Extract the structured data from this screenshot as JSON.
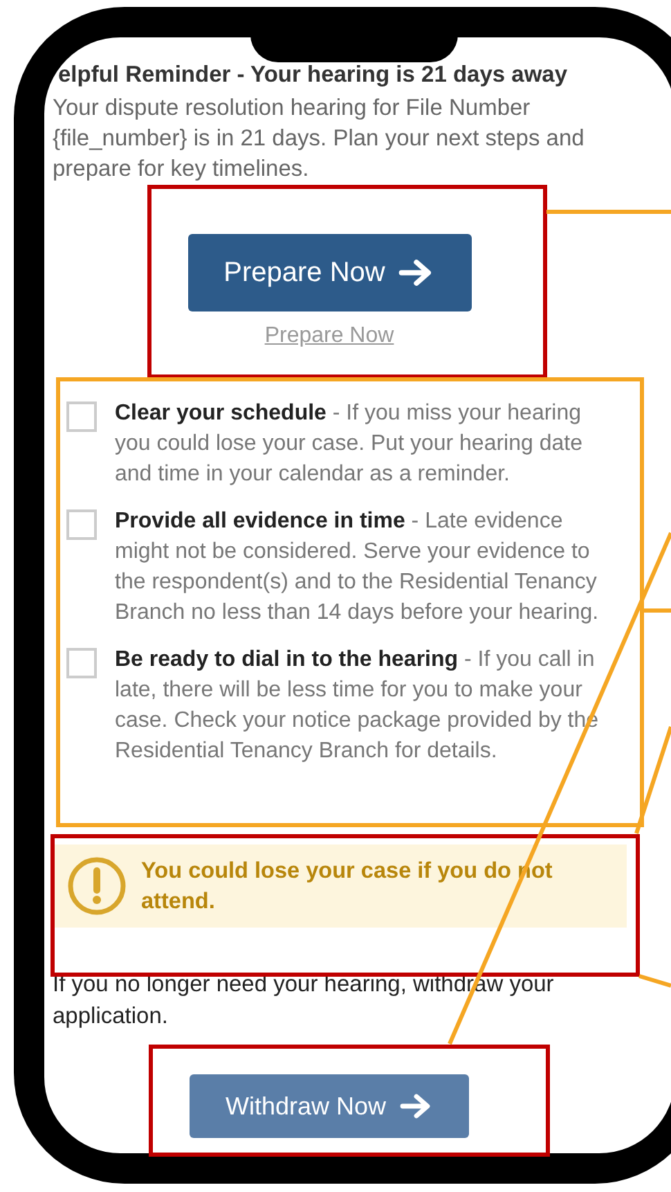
{
  "heading": "elpful Reminder - Your hearing is 21 days away",
  "intro": "Your dispute resolution hearing for File Number {file_number} is in 21 days. Plan your next steps and prepare for key timelines.",
  "prepare_button": {
    "label": "Prepare Now"
  },
  "prepare_link": "Prepare Now",
  "checklist": [
    {
      "text": "**Clear your schedule** - If you miss your hearing you could lose your case. Put your hearing date and time in your calendar as a reminder.",
      "checked": false
    },
    {
      "text": "**Provide all evidence in time** - Late evidence might not be considered. Serve your evidence to the respondent(s) and to the Residential Tenancy Branch no less than 14 days before your hearing.",
      "checked": false
    },
    {
      "text": "**Be ready to dial in to the hearing** - If you call in late, there will be less time for you to make your case. Check your notice package provided by the Residential Tenancy Branch for details.",
      "checked": false
    }
  ],
  "warning": "You could lose your case if you do not attend.",
  "withdraw_note": "If you no longer need your hearing, withdraw your application.",
  "withdraw_button": {
    "label": "Withdraw Now"
  }
}
